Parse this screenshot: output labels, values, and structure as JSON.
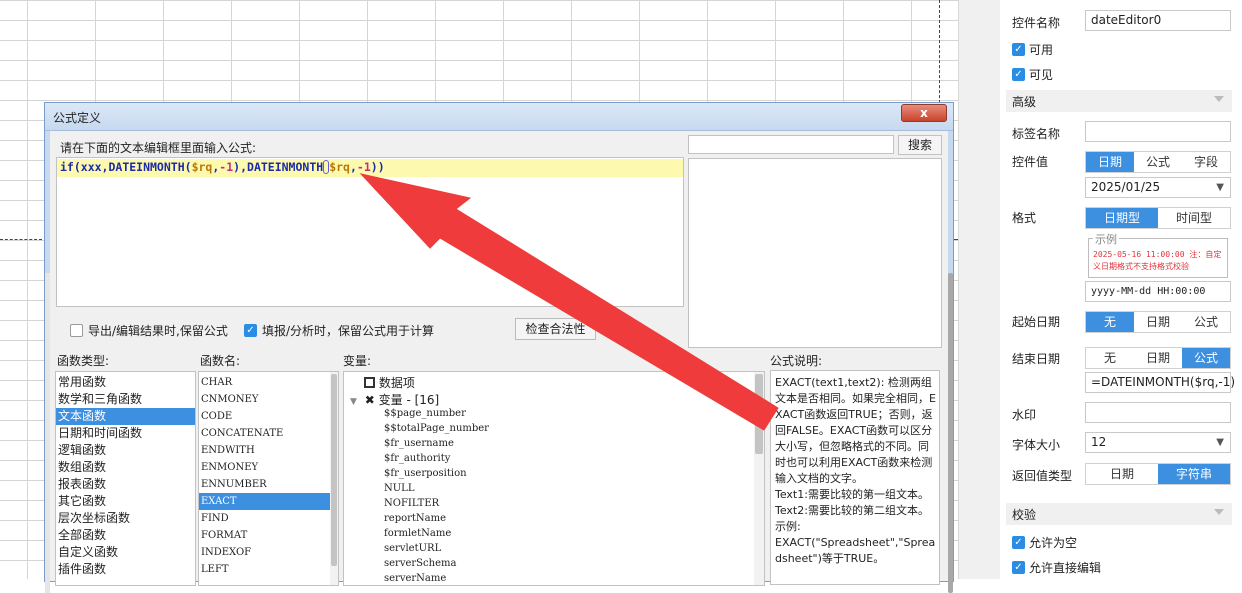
{
  "panel": {
    "control_name_label": "控件名称",
    "control_name_value": "dateEditor0",
    "enabled_label": "可用",
    "visible_label": "可见",
    "advanced_section": "高级",
    "tag_name_label": "标签名称",
    "tag_name_value": "",
    "control_value_label": "控件值",
    "control_value_tabs": [
      "日期",
      "公式",
      "字段"
    ],
    "control_value_date": "2025/01/25",
    "format_label": "格式",
    "format_tabs": [
      "日期型",
      "时间型"
    ],
    "sample_legend": "示例",
    "sample_text": "2025-05-16 11:00:00 注：自定义日期格式不支持格式校验",
    "format_value": "yyyy-MM-dd HH:00:00",
    "start_date_label": "起始日期",
    "start_date_tabs": [
      "无",
      "日期",
      "公式"
    ],
    "end_date_label": "结束日期",
    "end_date_tabs": [
      "无",
      "日期",
      "公式"
    ],
    "end_date_formula": "=DATEINMONTH($rq,-1)",
    "watermark_label": "水印",
    "watermark_value": "",
    "font_size_label": "字体大小",
    "font_size_value": "12",
    "return_type_label": "返回值类型",
    "return_type_tabs": [
      "日期",
      "字符串"
    ],
    "validate_section": "校验",
    "allow_empty_label": "允许为空",
    "allow_edit_label": "允许直接编辑"
  },
  "dialog": {
    "title": "公式定义",
    "close_glyph": "x",
    "prompt": "请在下面的文本编辑框里面输入公式:",
    "formula_parts": [
      "if(xxx,",
      "DATEINMONTH(",
      "$rq",
      ",",
      "-1",
      ")",
      ",",
      "DATEINMONTH",
      "(",
      "$rq",
      ",",
      "-1",
      "))"
    ],
    "search_value": "",
    "search_button": "搜索",
    "option_export": "导出/编辑结果时,保留公式",
    "option_fill": "填报/分析时，保留公式用于计算",
    "check_button": "检查合法性",
    "func_type_label": "函数类型:",
    "func_name_label": "函数名:",
    "variable_label": "变量:",
    "desc_label": "公式说明:",
    "func_types": [
      "常用函数",
      "数学和三角函数",
      "文本函数",
      "日期和时间函数",
      "逻辑函数",
      "数组函数",
      "报表函数",
      "其它函数",
      "层次坐标函数",
      "全部函数",
      "自定义函数",
      "插件函数"
    ],
    "func_types_selected": 2,
    "func_names": [
      "CHAR",
      "CNMONEY",
      "CODE",
      "CONCATENATE",
      "ENDWITH",
      "ENMONEY",
      "ENNUMBER",
      "EXACT",
      "FIND",
      "FORMAT",
      "INDEXOF",
      "LEFT"
    ],
    "func_names_selected": 7,
    "variables": {
      "dataset_node": "数据项",
      "var_node": "变量 - [16]",
      "leaves": [
        "$$page_number",
        "$$totalPage_number",
        "$fr_username",
        "$fr_authority",
        "$fr_userposition",
        "NULL",
        "NOFILTER",
        "reportName",
        "formletName",
        "servletURL",
        "serverSchema",
        "serverName"
      ]
    },
    "description": "EXACT(text1,text2): 检测两组文本是否相同。如果完全相同，EXACT函数返回TRUE；否则，返回FALSE。EXACT函数可以区分大小写，但忽略格式的不同。同时也可以利用EXACT函数来检测输入文档的文字。\nText1:需要比较的第一组文本。\nText2:需要比较的第二组文本。\n示例:\nEXACT(\"Spreadsheet\",\"Spreadsheet\")等于TRUE。"
  },
  "colors": {
    "accent": "#3d8fe0",
    "arrow": "#ef3b3b",
    "highlight_line": "#fdfab0"
  }
}
